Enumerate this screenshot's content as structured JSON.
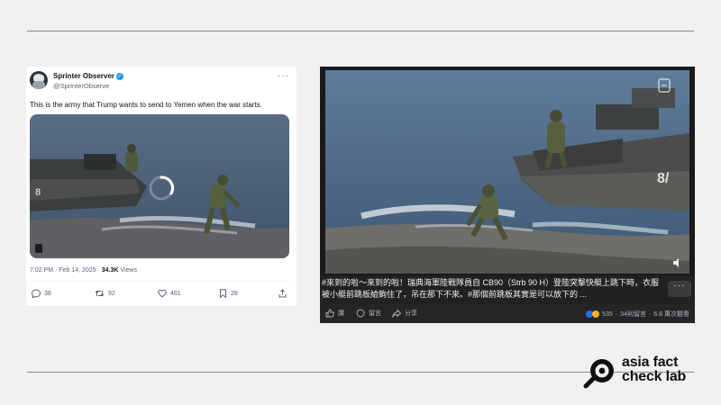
{
  "tweet": {
    "display_name": "Sprinter Observer",
    "handle": "@SprinterObserve",
    "more_label": "···",
    "text": "This is the army that Trump wants to send to Yemen when the war starts.",
    "time": "7:02 PM · Feb 14, 2025 · ",
    "views_count": "34.3K",
    "views_label": " Views",
    "replies": "38",
    "reposts": "92",
    "likes": "461",
    "bookmarks": "28",
    "loading_spinner": "spinner-icon"
  },
  "video": {
    "caption": "#來到的啦～來到的啦！瑞典海軍陸戰隊員自 CB90（Strb 90 H）登陸突擊快艇上跳下時，衣服被小艇前跳板給鉤住了，吊在那下不來。#那個前跳板其實是可以放下的 ...",
    "menu_label": "···",
    "like_label": "讚",
    "comment_label": "留言",
    "share_label": "分享",
    "reaction_count": "535",
    "comments_count": "34則留言",
    "views": "6.8 萬次觀看",
    "overlay_label": "8/",
    "stats_sep": "·"
  },
  "logo": {
    "line1": "asia fact",
    "line2": "check lab"
  },
  "colors": {
    "background": "#f1f1f1",
    "verified": "#1d9bf0",
    "caption_bg": "#212121",
    "logo": "#111111"
  }
}
